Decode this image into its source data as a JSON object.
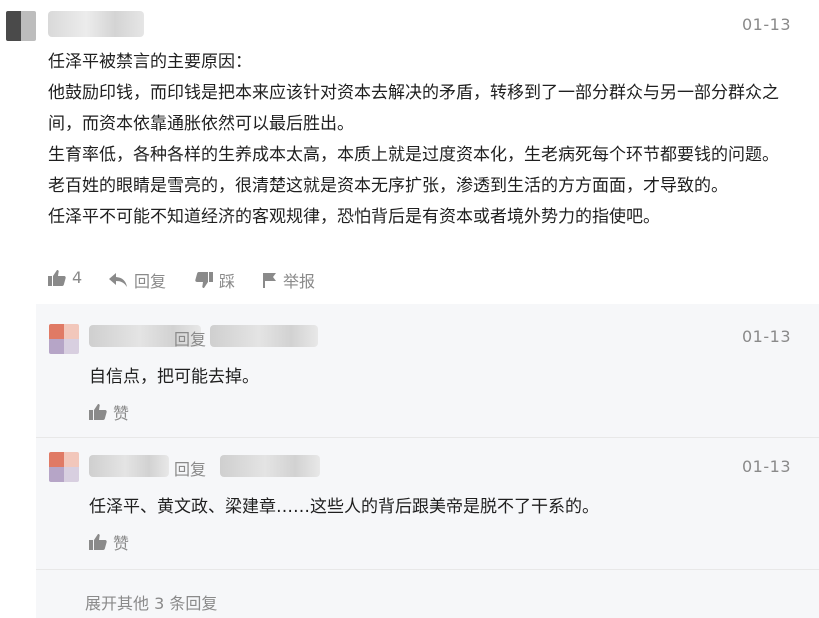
{
  "main_comment": {
    "date": "01-13",
    "paragraphs": [
      "任泽平被禁言的主要原因：",
      "他鼓励印钱，而印钱是把本来应该针对资本去解决的矛盾，转移到了一部分群众与另一部分群众之间，而资本依靠通胀依然可以最后胜出。",
      "生育率低，各种各样的生养成本太高，本质上就是过度资本化，生老病死每个环节都要钱的问题。老百姓的眼睛是雪亮的，很清楚这就是资本无序扩张，渗透到生活的方方面面，才导致的。",
      "任泽平不可能不知道经济的客观规律，恐怕背后是有资本或者境外势力的指使吧。"
    ],
    "like_count": "4",
    "reply_label": "回复",
    "dislike_label": "踩",
    "report_label": "举报"
  },
  "replies": [
    {
      "reply_word": "回复",
      "date": "01-13",
      "text": "自信点，把可能去掉。",
      "like_label": "赞"
    },
    {
      "reply_word": "回复",
      "date": "01-13",
      "text": "任泽平、黄文政、梁建章……这些人的背后跟美帝是脱不了干系的。",
      "like_label": "赞"
    }
  ],
  "expand_more": "展开其他 3 条回复",
  "colors": {
    "meta_gray": "#8a8a8a",
    "reply_bg": "#f6f7f9",
    "text": "#1f1f1f"
  }
}
